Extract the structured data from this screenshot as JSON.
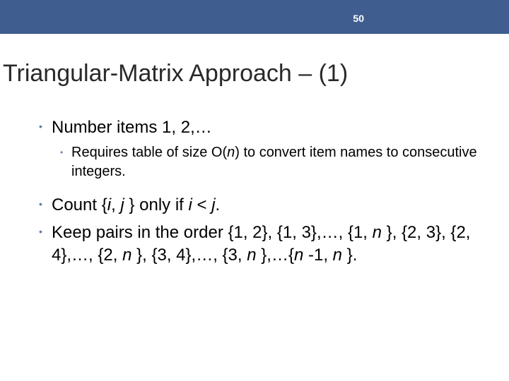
{
  "page_number": "50",
  "title": "Triangular-Matrix Approach – (1)",
  "bullets": [
    {
      "text": "Number items 1, 2,…",
      "sub": [
        {
          "html": "Requires table of size O(<i>n</i>) to convert item names to consecutive integers."
        }
      ]
    },
    {
      "html": "Count {<i>i</i>, <i>j</i> } only if <i>i</i> &lt; <i>j</i>."
    },
    {
      "html": "Keep pairs in the order {1, 2}, {1, 3},…, {1, <i>n</i> }, {2, 3}, {2, 4},…, {2, <i>n</i> }, {3, 4},…, {3, <i>n</i> },…{<i>n</i> -1, <i>n</i> }."
    }
  ]
}
